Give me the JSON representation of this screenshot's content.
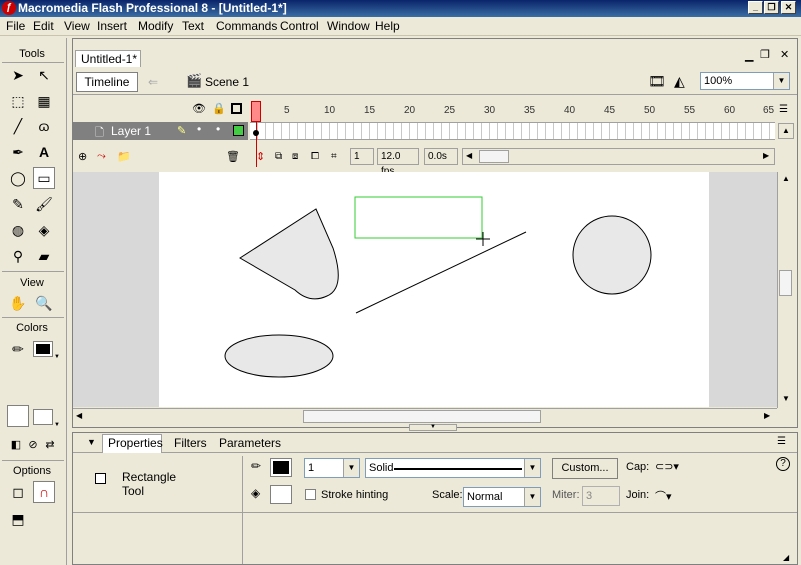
{
  "window": {
    "title": "Macromedia Flash Professional 8 - [Untitled-1*]",
    "icon": "flash-app-icon"
  },
  "menu": [
    "File",
    "Edit",
    "View",
    "Insert",
    "Modify",
    "Text",
    "Commands",
    "Control",
    "Window",
    "Help"
  ],
  "tools_panel": {
    "title": "Tools",
    "view_label": "View",
    "colors_label": "Colors",
    "options_label": "Options",
    "stroke_color": "#000000",
    "fill_color": "#ffffff"
  },
  "document": {
    "tab": "Untitled-1*",
    "timeline_button": "Timeline",
    "scene": "Scene 1",
    "zoom": "100%"
  },
  "timeline": {
    "layer_name": "Layer 1",
    "frame_numbers": [
      "1",
      "5",
      "10",
      "15",
      "20",
      "25",
      "30",
      "35",
      "40",
      "45",
      "50",
      "55",
      "60",
      "65"
    ],
    "current_frame": "1",
    "fps": "12.0 fps",
    "time": "0.0s"
  },
  "properties": {
    "tabs": [
      "Properties",
      "Filters",
      "Parameters"
    ],
    "tool_name": "Rectangle\nTool",
    "stroke_weight": "1",
    "stroke_style": "Solid",
    "custom_button": "Custom...",
    "cap_label": "Cap:",
    "stroke_hinting_label": "Stroke hinting",
    "scale_label": "Scale:",
    "scale_value": "Normal",
    "miter_label": "Miter:",
    "miter_value": "3",
    "join_label": "Join:"
  },
  "colors": {
    "title_bar": "#0a246a",
    "stage": "#ffffff",
    "shape_fill": "#e8e8e8",
    "selection_rect": "#33cc33"
  }
}
